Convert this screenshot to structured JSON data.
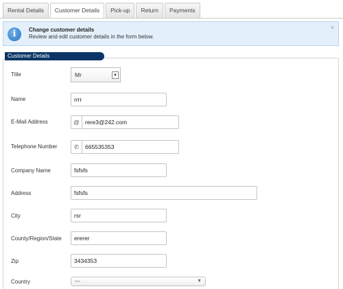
{
  "tabs": [
    "Rental Details",
    "Customer Details",
    "Pick-up",
    "Return",
    "Payments"
  ],
  "notice": {
    "icon": "info-icon",
    "title": "Change customer details",
    "text": "Review and edit customer details in the form below.",
    "close": "×"
  },
  "section": {
    "title": "Customer Details"
  },
  "form": {
    "title_label": "Title",
    "title_value": "Mr",
    "name_label": "Name",
    "name_value": "rrrr",
    "email_label": "E-Mail Address",
    "email_addon": "@",
    "email_value": "rere3@242.com",
    "phone_label": "Telephone Number",
    "phone_addon": "📞",
    "phone_value": "665535353",
    "company_label": "Company Name",
    "company_value": "fsfsfs",
    "address_label": "Address",
    "address_value": "fsfsfs",
    "city_label": "City",
    "city_value": "rsr",
    "county_label": "County/Region/State",
    "county_value": "ererer",
    "zip_label": "Zip",
    "zip_value": "3434353",
    "country_label": "Country",
    "country_value": "---"
  },
  "colors": {
    "legend_bg": "#0b3566",
    "notice_bg": "#e3f0fb",
    "notice_border": "#b7d3ec"
  }
}
